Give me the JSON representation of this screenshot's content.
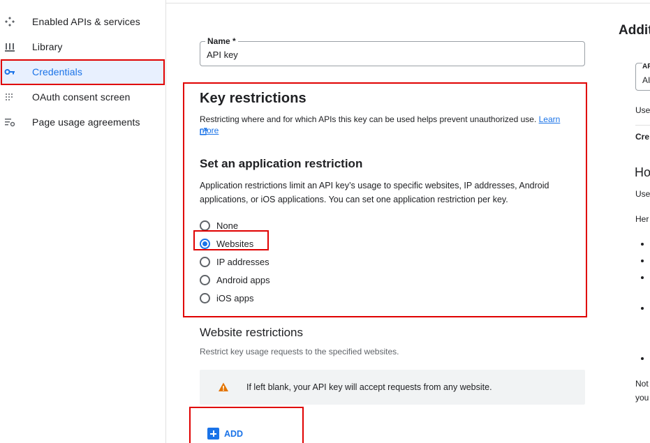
{
  "sidebar": {
    "items": [
      {
        "label": "Enabled APIs & services",
        "icon": "api-diamond-icon"
      },
      {
        "label": "Library",
        "icon": "library-icon"
      },
      {
        "label": "Credentials",
        "icon": "key-icon",
        "active": true
      },
      {
        "label": "OAuth consent screen",
        "icon": "oauth-dots-icon"
      },
      {
        "label": "Page usage agreements",
        "icon": "settings-list-icon"
      }
    ]
  },
  "name_field": {
    "label": "Name *",
    "value": "API key"
  },
  "key_restrictions": {
    "title": "Key restrictions",
    "description": "Restricting where and for which APIs this key can be used helps prevent unauthorized use.",
    "learn_more": "Learn more"
  },
  "application_restriction": {
    "title": "Set an application restriction",
    "description": "Application restrictions limit an API key’s usage to specific websites, IP addresses, Android applications, or iOS applications. You can set one application restriction per key.",
    "options": [
      "None",
      "Websites",
      "IP addresses",
      "Android apps",
      "iOS apps"
    ],
    "selected": "Websites"
  },
  "website_restrictions": {
    "title": "Website restrictions",
    "description": "Restrict key usage requests to the specified websites.",
    "warning": "If left blank, your API key will accept requests from any website.",
    "add_label": "ADD"
  },
  "right_panel": {
    "title": "Additi",
    "field_label": "AP",
    "field_value": "AI",
    "texts": [
      "Use",
      "Cre",
      "Use",
      "Her",
      "Not",
      "you"
    ],
    "heading": "Ho"
  },
  "colors": {
    "accent": "#1a73e8",
    "annotation": "#e00000",
    "warning": "#e37400"
  }
}
